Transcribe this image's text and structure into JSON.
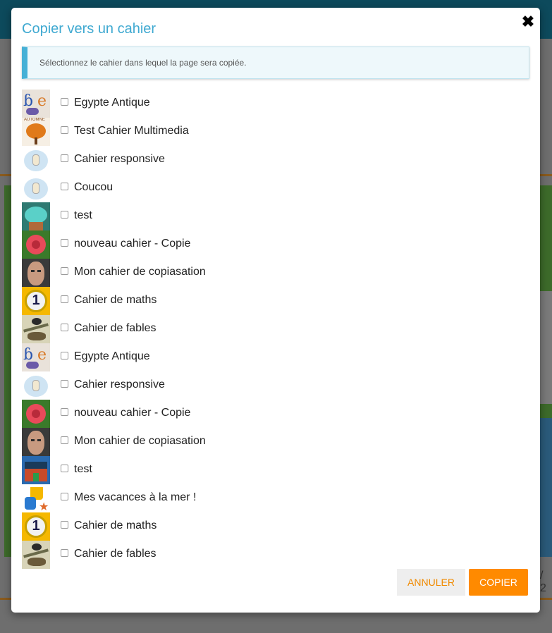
{
  "background": {
    "pager_text": "/ 2"
  },
  "modal": {
    "title": "Copier vers un cahier",
    "close_icon": "close-icon",
    "info": "Sélectionnez le cahier dans lequel la page sera copiée.",
    "notebooks": [
      {
        "label": "Egypte Antique",
        "thumb": "egypt",
        "checked": false
      },
      {
        "label": "Test Cahier Multimedia",
        "thumb": "autumn",
        "checked": false
      },
      {
        "label": "Cahier responsive",
        "thumb": "figure",
        "checked": false
      },
      {
        "label": "Coucou",
        "thumb": "figure",
        "checked": false
      },
      {
        "label": "test",
        "thumb": "cupcake",
        "checked": false
      },
      {
        "label": "nouveau cahier - Copie",
        "thumb": "rose",
        "checked": false
      },
      {
        "label": "Mon cahier de copiasation",
        "thumb": "face",
        "checked": false
      },
      {
        "label": "Cahier de maths",
        "thumb": "one",
        "checked": false
      },
      {
        "label": "Cahier de fables",
        "thumb": "fable",
        "checked": false
      },
      {
        "label": "Egypte Antique",
        "thumb": "egypt",
        "checked": false
      },
      {
        "label": "Cahier responsive",
        "thumb": "figure",
        "checked": false
      },
      {
        "label": "nouveau cahier - Copie",
        "thumb": "rose",
        "checked": false
      },
      {
        "label": "Mon cahier de copiasation",
        "thumb": "face",
        "checked": false
      },
      {
        "label": "test",
        "thumb": "house",
        "checked": false
      },
      {
        "label": "Mes vacances à la mer !",
        "thumb": "beach",
        "checked": false
      },
      {
        "label": "Cahier de maths",
        "thumb": "one",
        "checked": false
      },
      {
        "label": "Cahier de fables",
        "thumb": "fable",
        "checked": false
      }
    ],
    "buttons": {
      "cancel": "ANNULER",
      "copy": "COPIER"
    }
  },
  "colors": {
    "accent": "#3fa9d1",
    "primary_button": "#ff8a00",
    "cancel_text": "#f08a00"
  }
}
